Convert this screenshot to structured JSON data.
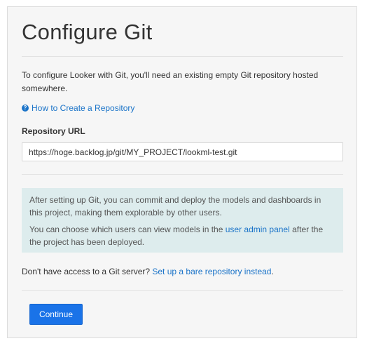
{
  "page": {
    "title": "Configure Git",
    "intro": "To configure Looker with Git, you'll need an existing empty Git repository hosted somewhere.",
    "howto_link": "How to Create a Repository",
    "repo_url_label": "Repository URL",
    "repo_url_value": "https://hoge.backlog.jp/git/MY_PROJECT/lookml-test.git",
    "info_box": {
      "paragraph1": "After setting up Git, you can commit and deploy the models and dashboards in this project, making them explorable by other users.",
      "paragraph2_prefix": "You can choose which users can view models in the ",
      "paragraph2_link": "user admin panel",
      "paragraph2_suffix": " after the the project has been deployed."
    },
    "no_access_prefix": "Don't have access to a Git server? ",
    "no_access_link": "Set up a bare repository instead",
    "no_access_suffix": ".",
    "continue_label": "Continue"
  },
  "icons": {
    "howto": "question-circle-icon"
  },
  "colors": {
    "link": "#1a73c8",
    "primary_button": "#1a73e8",
    "info_background": "#ddeced",
    "panel_background": "#f6f6f6"
  }
}
